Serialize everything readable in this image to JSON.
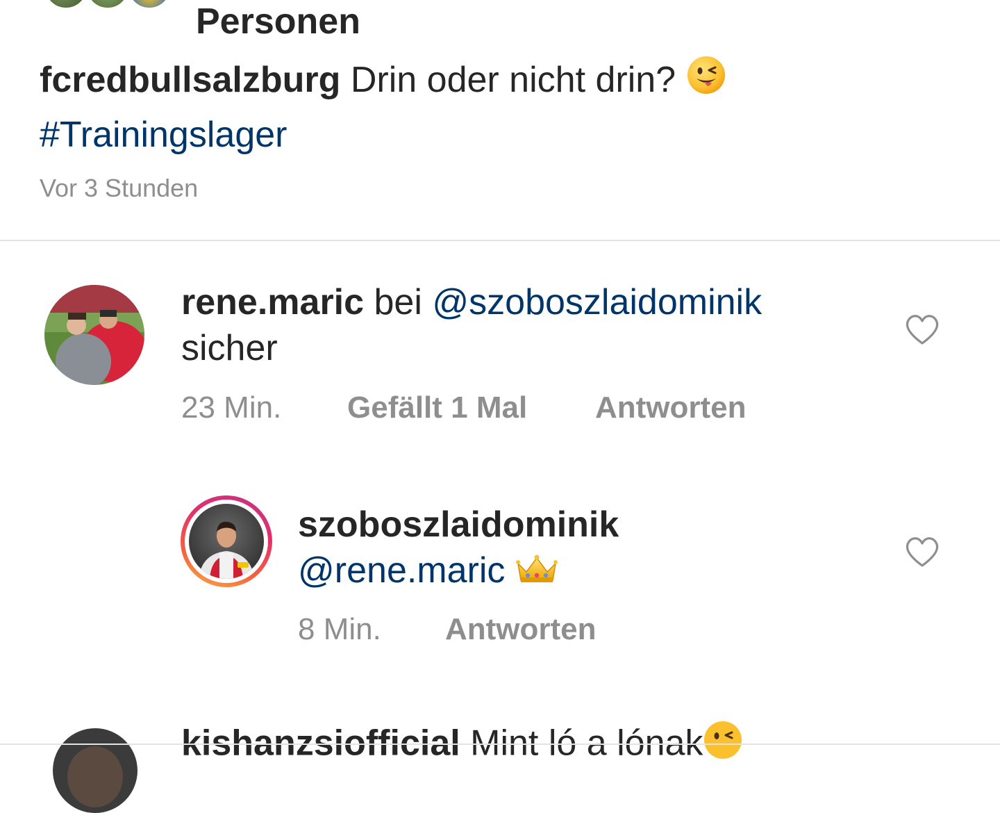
{
  "liked_by": {
    "label": "Personen"
  },
  "caption": {
    "username": "fcredbullsalzburg",
    "text": "Drin oder nicht drin?",
    "hashtag": "#Trainingslager",
    "time": "Vor 3 Stunden",
    "emoji": "winking-face-tongue-emoji"
  },
  "comments": [
    {
      "username": "rene.maric",
      "text_before": "bei",
      "mention": "@szoboszlaidominik",
      "text_after": "sicher",
      "time": "23 Min.",
      "likes": "Gefällt 1 Mal",
      "reply_label": "Antworten",
      "icon": "heart-outline-icon"
    },
    {
      "username": "szoboszlaidominik",
      "mention": "@rene.maric",
      "emoji": "crown-emoji",
      "time": "8 Min.",
      "reply_label": "Antworten",
      "icon": "heart-outline-icon",
      "has_story_ring": true
    },
    {
      "username": "kishanzsiofficial",
      "text": "Mint ló a lónak",
      "emoji": "winking-face-tongue-emoji"
    }
  ],
  "colors": {
    "text": "#262626",
    "secondary": "#8e8e8e",
    "link": "#003569",
    "divider": "#e3e3e3",
    "story_ring_start": "#f58529",
    "story_ring_end": "#dd2a7b"
  }
}
